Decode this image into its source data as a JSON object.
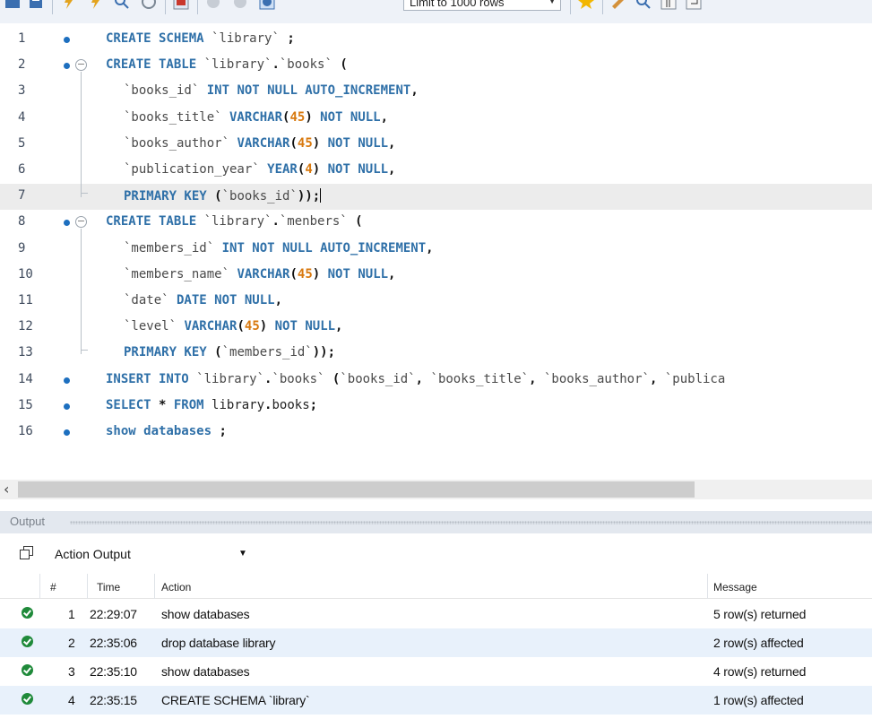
{
  "toolbar": {
    "limit_label": "Limit to 1000 rows",
    "icons": [
      "folder-open-icon",
      "save-icon",
      "execute-icon",
      "execute-current-icon",
      "explain-icon",
      "stop-icon",
      "toggle-results-icon",
      "commit-icon",
      "rollback-icon",
      "autocommit-icon",
      "bookmark-add-icon",
      "beautify-icon",
      "find-icon",
      "invisible-chars-icon",
      "wrap-icon"
    ]
  },
  "editor": {
    "lines": [
      {
        "n": "1",
        "html": "CREATE SCHEMA <s>`library`</s> <p>;</p>"
      },
      {
        "n": "2",
        "html": "CREATE TABLE <s>`library`</s><p>.</p><s>`books`</s> <p>(</p>"
      },
      {
        "n": "3",
        "html": "  <s>`books_id`</s> INT NOT NULL AUTO_INCREMENT<p>,</p>"
      },
      {
        "n": "4",
        "html": "  <s>`books_title`</s> VARCHAR<p>(</p><d>45</d><p>)</p> NOT NULL<p>,</p>"
      },
      {
        "n": "5",
        "html": "  <s>`books_author`</s> VARCHAR<p>(</p><d>45</d><p>)</p> NOT NULL<p>,</p>"
      },
      {
        "n": "6",
        "html": "  <s>`publication_year`</s> YEAR<p>(</p><d>4</d><p>)</p> NOT NULL<p>,</p>"
      },
      {
        "n": "7",
        "html": "  PRIMARY KEY <p>(</p><s>`books_id`</s><p>));</p>"
      },
      {
        "n": "8",
        "html": "CREATE TABLE <s>`library`</s><p>.</p><s>`menbers`</s> <p>(</p>"
      },
      {
        "n": "9",
        "html": "  <s>`members_id`</s> INT NOT NULL AUTO_INCREMENT<p>,</p>"
      },
      {
        "n": "10",
        "html": "  <s>`members_name`</s> VARCHAR<p>(</p><d>45</d><p>)</p> NOT NULL<p>,</p>"
      },
      {
        "n": "11",
        "html": "  <s>`date`</s> DATE NOT NULL<p>,</p>"
      },
      {
        "n": "12",
        "html": "  <s>`level`</s> VARCHAR<p>(</p><d>45</d><p>)</p> NOT NULL<p>,</p>"
      },
      {
        "n": "13",
        "html": "  PRIMARY KEY <p>(</p><s>`members_id`</s><p>));</p>"
      },
      {
        "n": "14",
        "html": "INSERT INTO <s>`library`</s><p>.</p><s>`books`</s> <p>(</p><s>`books_id`</s><p>,</p> <s>`books_title`</s><p>,</p> <s>`books_author`</s><p>,</p> <s>`publica</s>"
      },
      {
        "n": "15",
        "html": "SELECT <p>*</p> FROM <i>library</i><p>.</p><i>books</i><p>;</p>"
      },
      {
        "n": "16",
        "html": "show databases <p>;</p>"
      }
    ]
  },
  "output": {
    "title": "Output",
    "selector": "Action Output",
    "columns": {
      "num": "#",
      "time": "Time",
      "action": "Action",
      "message": "Message"
    },
    "rows": [
      {
        "num": "1",
        "time": "22:29:07",
        "action": "show databases",
        "message": "5 row(s) returned"
      },
      {
        "num": "2",
        "time": "22:35:06",
        "action": "drop database library",
        "message": "2 row(s) affected"
      },
      {
        "num": "3",
        "time": "22:35:10",
        "action": "show databases",
        "message": "4 row(s) returned"
      },
      {
        "num": "4",
        "time": "22:35:15",
        "action": "CREATE SCHEMA `library`",
        "message": "1 row(s) affected"
      }
    ]
  }
}
